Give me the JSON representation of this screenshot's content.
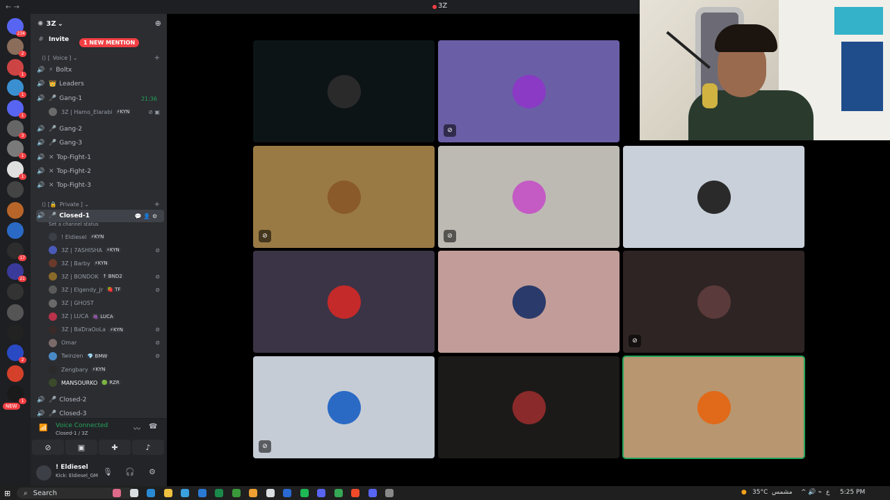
{
  "titlebar": {
    "title": "3Z",
    "back": "←  →"
  },
  "server_rail": {
    "servers": [
      {
        "name": "home",
        "badge": "234",
        "color": "#5865f2"
      },
      {
        "name": "srv1",
        "badge": "2",
        "color": "#8a6d5a"
      },
      {
        "name": "srv2",
        "badge": "1",
        "color": "#c44"
      },
      {
        "name": "srv3",
        "badge": "1",
        "color": "#3a8fd1"
      },
      {
        "name": "srv4",
        "badge": "1",
        "color": "#5865f2"
      },
      {
        "name": "srv5",
        "badge": "3",
        "color": "#666"
      },
      {
        "name": "srv6",
        "badge": "1",
        "color": "#7a7a7a"
      },
      {
        "name": "srv7",
        "badge": "1",
        "color": "#e0e0e0"
      },
      {
        "name": "srv8",
        "badge": "",
        "color": "#444"
      },
      {
        "name": "srv9",
        "badge": "",
        "color": "#b8652a"
      },
      {
        "name": "srv10",
        "badge": "",
        "color": "#2a6ac4"
      },
      {
        "name": "srv11",
        "badge": "17",
        "color": "#2d2d2d"
      },
      {
        "name": "srv12",
        "badge": "21",
        "color": "#3a3a9a"
      },
      {
        "name": "srv13",
        "badge": "",
        "color": "#333"
      },
      {
        "name": "srv14",
        "badge": "",
        "color": "#555"
      },
      {
        "name": "srv15",
        "badge": "",
        "color": "#222"
      },
      {
        "name": "srv16",
        "badge": "2",
        "color": "#2a4ac4"
      },
      {
        "name": "srv17",
        "badge": "",
        "color": "#d4402a"
      },
      {
        "name": "srv18",
        "badge": "1",
        "color": "#1a1a1a"
      }
    ],
    "new_label": "NEW"
  },
  "sidebar": {
    "server_name": "3Z",
    "new_mention": "1 NEW MENTION",
    "invite_channel": "Invite",
    "voice_category": "Voice",
    "private_category": "Private",
    "channels": [
      {
        "name": "Boltx",
        "icon": "⚡"
      },
      {
        "name": "Leaders",
        "icon": "👑"
      },
      {
        "name": "Gang-1",
        "icon": "🎤",
        "time": "21:36"
      },
      {
        "name": "Gang-2",
        "icon": "🎤"
      },
      {
        "name": "Gang-3",
        "icon": "🎤"
      },
      {
        "name": "Top-Fight-1",
        "icon": "✕"
      },
      {
        "name": "Top-Fight-2",
        "icon": "✕"
      },
      {
        "name": "Top-Fight-3",
        "icon": "✕"
      }
    ],
    "gang1_member": {
      "name": "3Z | Hamo_Elarabi",
      "tag": "⚡KYN"
    },
    "active_channel": "Closed-1",
    "channel_status_hint": "Set a channel status",
    "members": [
      {
        "name": "! Eldiesel",
        "tag": "⚡KYN",
        "color": "#3c3f45"
      },
      {
        "name": "3Z | 7ASHISHA",
        "tag": "⚡KYN",
        "color": "#4a5ab8"
      },
      {
        "name": "3Z | Barby",
        "tag": "⚡KYN",
        "color": "#6b3a2a"
      },
      {
        "name": "3Z | BONDOK",
        "tag": "↑ BND2",
        "color": "#8a6a2a"
      },
      {
        "name": "3Z | Elgendy_Jr",
        "tag": "🍓 TF",
        "color": "#5a5a5a"
      },
      {
        "name": "3Z | GHOST",
        "tag": "",
        "color": "#6a6a6a"
      },
      {
        "name": "3Z | LUCA",
        "tag": "🍇 LUCA",
        "color": "#b8324a"
      },
      {
        "name": "3Z | BaƊraOoLa",
        "tag": "⚡KYN",
        "color": "#3a2a2a"
      },
      {
        "name": "Omar",
        "tag": "",
        "color": "#7a6a6a"
      },
      {
        "name": "Twinzen",
        "tag": "💎 BMW",
        "color": "#4a8ac4"
      },
      {
        "name": "Zengbary",
        "tag": "⚡KYN",
        "color": "#2a2a2a"
      },
      {
        "name": "MANSOURKO",
        "tag": "🟢 RZR",
        "color": "#3a4a2a"
      }
    ],
    "more_channels": [
      "Closed-2",
      "Closed-3"
    ]
  },
  "voice_panel": {
    "status": "Voice Connected",
    "channel": "Closed-1 / 3Z"
  },
  "user_panel": {
    "username": "! Eldiesel",
    "status": "Kick: Eldiesel_GM"
  },
  "tiles": [
    {
      "bg": "#0d1416",
      "pfp": "#2a2a2a",
      "muted": false,
      "speaking": false
    },
    {
      "bg": "#6a5fa6",
      "pfp": "#8a3ac4",
      "muted": true,
      "speaking": false
    },
    {
      "bg": "#9a7a44",
      "pfp": "#8a5a2a",
      "muted": true,
      "speaking": false
    },
    {
      "bg": "#bdbab4",
      "pfp": "#c45ac4",
      "muted": true,
      "speaking": false
    },
    {
      "bg": "#c9d0da",
      "pfp": "#2a2a2a",
      "muted": false,
      "speaking": false
    },
    {
      "bg": "#3a3446",
      "pfp": "#c42a2a",
      "muted": false,
      "speaking": false
    },
    {
      "bg": "#c29c98",
      "pfp": "#2a3a6a",
      "muted": false,
      "speaking": false
    },
    {
      "bg": "#2e2424",
      "pfp": "#5a3a3a",
      "muted": true,
      "speaking": false
    },
    {
      "bg": "#c6ccd6",
      "pfp": "#2a6ac4",
      "muted": true,
      "speaking": false
    },
    {
      "bg": "#1c1a18",
      "pfp": "#8a2a2a",
      "muted": false,
      "speaking": false
    },
    {
      "bg": "#b89670",
      "pfp": "#e06a1a",
      "muted": false,
      "speaking": true
    }
  ],
  "taskbar": {
    "search_placeholder": "Search",
    "weather": "35°C",
    "weather_desc": "مشمس",
    "lang": "ع",
    "time": "5:25 PM"
  }
}
